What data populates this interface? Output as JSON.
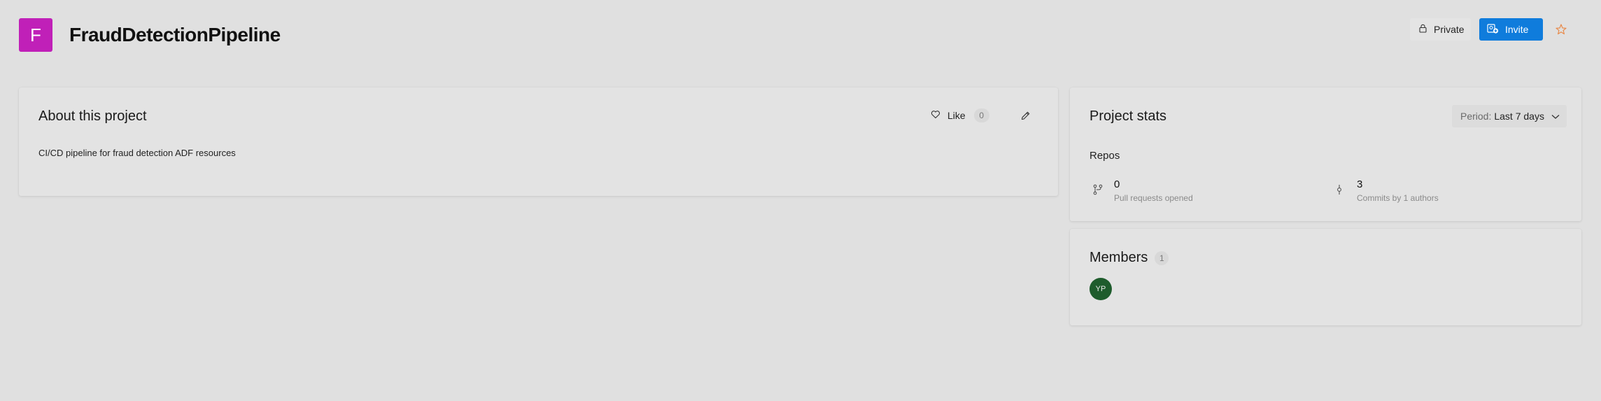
{
  "project": {
    "initial": "F",
    "name": "FraudDetectionPipeline",
    "avatar_color": "#c020b8"
  },
  "header": {
    "private_label": "Private",
    "invite_label": "Invite",
    "invite_color": "#0f7cdc",
    "star_icon": "star-icon",
    "star_color": "#e88a4a"
  },
  "about": {
    "title": "About this project",
    "like_label": "Like",
    "like_count": "0",
    "description": "CI/CD pipeline for fraud detection ADF resources"
  },
  "stats": {
    "title": "Project stats",
    "period_label": "Period:",
    "period_value": "Last 7 days",
    "section_label": "Repos",
    "pull_requests": {
      "value": "0",
      "caption": "Pull requests opened",
      "icon": "pull-request-icon"
    },
    "commits": {
      "value": "3",
      "caption": "Commits by 1 authors",
      "icon": "commit-icon"
    }
  },
  "members": {
    "title": "Members",
    "count": "1",
    "list": [
      {
        "initials": "YP",
        "color": "#1e5c2c"
      }
    ]
  }
}
